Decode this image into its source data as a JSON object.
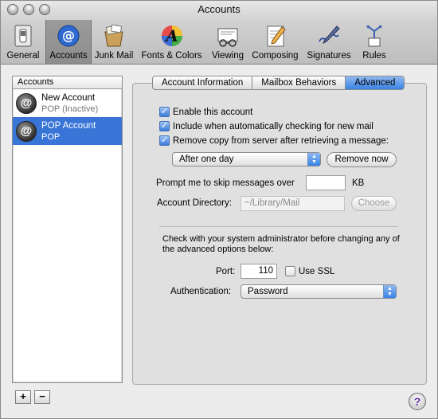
{
  "window": {
    "title": "Accounts"
  },
  "toolbar": {
    "items": [
      {
        "label": "General",
        "icon": "switch-icon"
      },
      {
        "label": "Accounts",
        "icon": "at-sign-icon"
      },
      {
        "label": "Junk Mail",
        "icon": "junk-mail-icon"
      },
      {
        "label": "Fonts & Colors",
        "icon": "fonts-colors-icon"
      },
      {
        "label": "Viewing",
        "icon": "viewing-icon"
      },
      {
        "label": "Composing",
        "icon": "composing-icon"
      },
      {
        "label": "Signatures",
        "icon": "signatures-icon"
      },
      {
        "label": "Rules",
        "icon": "rules-icon"
      }
    ],
    "selected_index": 1
  },
  "accounts_list": {
    "header": "Accounts",
    "items": [
      {
        "name": "New Account",
        "type": "POP (Inactive)"
      },
      {
        "name": "POP Account",
        "type": "POP"
      }
    ],
    "selected_index": 1,
    "add_label": "+",
    "remove_label": "−"
  },
  "tabs": {
    "items": [
      "Account Information",
      "Mailbox Behaviors",
      "Advanced"
    ],
    "active_index": 2
  },
  "advanced": {
    "enable_account": {
      "label": "Enable this account",
      "checked": true
    },
    "include_checking": {
      "label": "Include when automatically checking for new mail",
      "checked": true
    },
    "remove_copy": {
      "label": "Remove copy from server after retrieving a message:",
      "checked": true
    },
    "remove_after": {
      "value": "After one day"
    },
    "remove_now_label": "Remove now",
    "prompt_skip": {
      "label": "Prompt me to skip messages over",
      "value": "",
      "unit": "KB"
    },
    "account_directory": {
      "label": "Account Directory:",
      "placeholder": "~/Library/Mail",
      "choose_label": "Choose"
    },
    "admin_note": "Check with your system administrator before changing any of the advanced options below:",
    "port": {
      "label": "Port:",
      "value": "110"
    },
    "use_ssl": {
      "label": "Use SSL",
      "checked": false
    },
    "authentication": {
      "label": "Authentication:",
      "value": "Password"
    }
  },
  "help_label": "?",
  "colors": {
    "accent": "#3875d7",
    "tab_active": "#3a83e6"
  }
}
